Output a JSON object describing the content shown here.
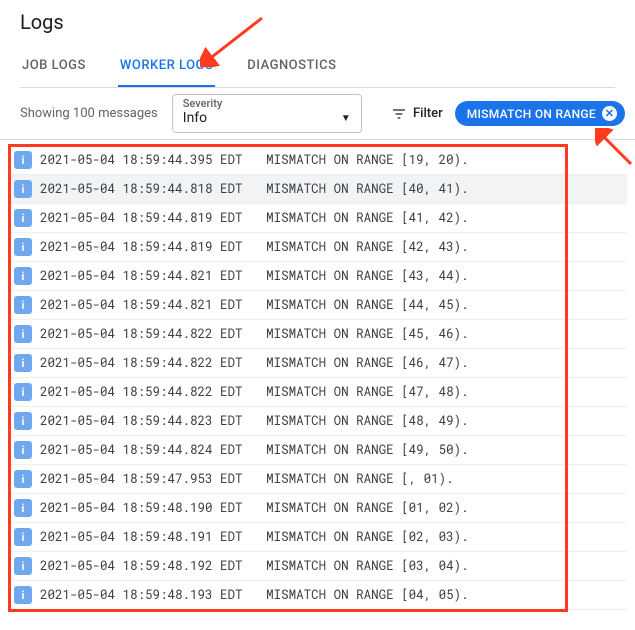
{
  "title": "Logs",
  "tabs": [
    {
      "id": "job-logs",
      "label": "JOB LOGS",
      "active": false
    },
    {
      "id": "worker-logs",
      "label": "WORKER LOGS",
      "active": true
    },
    {
      "id": "diagnostics",
      "label": "DIAGNOSTICS",
      "active": false
    }
  ],
  "controls": {
    "showing_text": "Showing 100 messages",
    "severity_label": "Severity",
    "severity_value": "Info",
    "filter_label": "Filter",
    "chip_label": "MISMATCH ON RANGE"
  },
  "log_prefix": {
    "date": "2021-05-04",
    "tz": "EDT"
  },
  "logs": [
    {
      "time": "18:59:44.395",
      "msg": "MISMATCH ON RANGE [19, 20).",
      "hl": false
    },
    {
      "time": "18:59:44.818",
      "msg": "MISMATCH ON RANGE [40, 41).",
      "hl": true
    },
    {
      "time": "18:59:44.819",
      "msg": "MISMATCH ON RANGE [41, 42).",
      "hl": false
    },
    {
      "time": "18:59:44.819",
      "msg": "MISMATCH ON RANGE [42, 43).",
      "hl": false
    },
    {
      "time": "18:59:44.821",
      "msg": "MISMATCH ON RANGE [43, 44).",
      "hl": false
    },
    {
      "time": "18:59:44.821",
      "msg": "MISMATCH ON RANGE [44, 45).",
      "hl": false
    },
    {
      "time": "18:59:44.822",
      "msg": "MISMATCH ON RANGE [45, 46).",
      "hl": false
    },
    {
      "time": "18:59:44.822",
      "msg": "MISMATCH ON RANGE [46, 47).",
      "hl": false
    },
    {
      "time": "18:59:44.822",
      "msg": "MISMATCH ON RANGE [47, 48).",
      "hl": false
    },
    {
      "time": "18:59:44.823",
      "msg": "MISMATCH ON RANGE [48, 49).",
      "hl": false
    },
    {
      "time": "18:59:44.824",
      "msg": "MISMATCH ON RANGE [49, 50).",
      "hl": false
    },
    {
      "time": "18:59:47.953",
      "msg": "MISMATCH ON RANGE [, 01).",
      "hl": false
    },
    {
      "time": "18:59:48.190",
      "msg": "MISMATCH ON RANGE [01, 02).",
      "hl": false
    },
    {
      "time": "18:59:48.191",
      "msg": "MISMATCH ON RANGE [02, 03).",
      "hl": false
    },
    {
      "time": "18:59:48.192",
      "msg": "MISMATCH ON RANGE [03, 04).",
      "hl": false
    },
    {
      "time": "18:59:48.193",
      "msg": "MISMATCH ON RANGE [04, 05).",
      "hl": false
    }
  ]
}
